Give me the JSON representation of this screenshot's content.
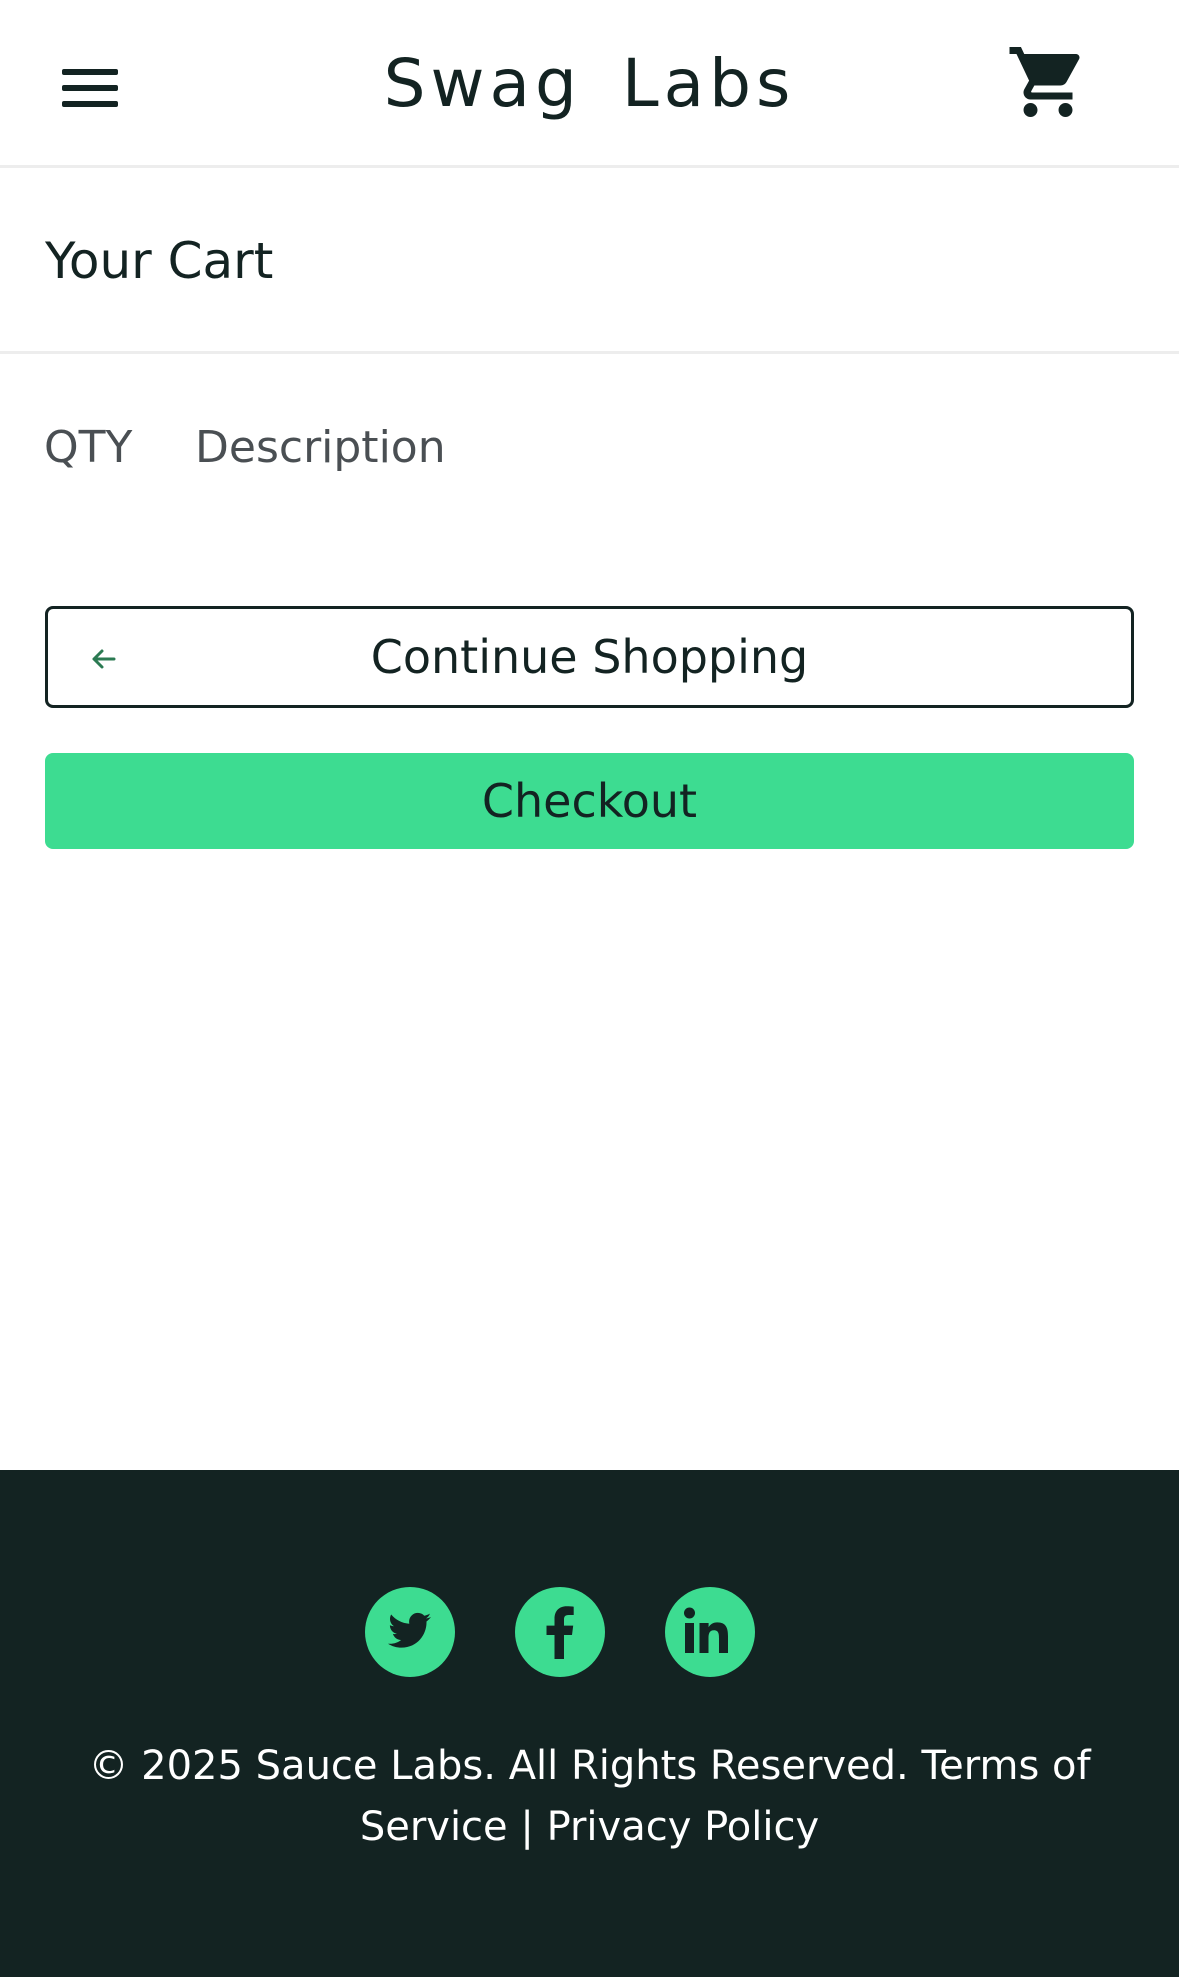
{
  "header": {
    "brand": "Swag Labs",
    "menu_icon": "hamburger-menu-icon",
    "cart_icon": "shopping-cart-icon"
  },
  "cart": {
    "title": "Your Cart",
    "columns": {
      "qty": "QTY",
      "description": "Description"
    },
    "items": []
  },
  "actions": {
    "continue_shopping": "Continue Shopping",
    "continue_icon": "arrow-left-icon",
    "checkout": "Checkout"
  },
  "footer": {
    "social": [
      {
        "name": "twitter",
        "icon": "twitter-icon"
      },
      {
        "name": "facebook",
        "icon": "facebook-icon"
      },
      {
        "name": "linkedin",
        "icon": "linkedin-icon"
      }
    ],
    "copyright": "© 2025 Sauce Labs. All Rights Reserved. Terms of Service | Privacy Policy"
  },
  "colors": {
    "accent": "#3ddc91",
    "dark": "#132322",
    "border": "#ededed",
    "muted_text": "#4a4f53",
    "background": "#ffffff"
  }
}
